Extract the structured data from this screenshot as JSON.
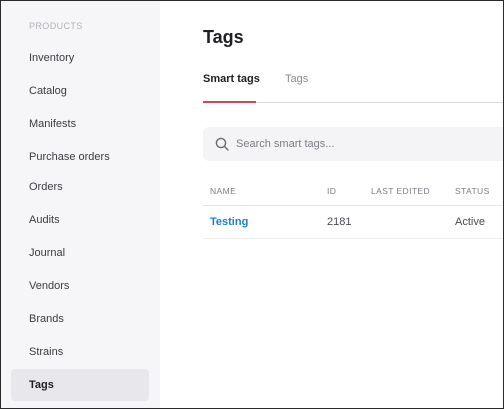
{
  "sidebar": {
    "section": "PRODUCTS",
    "items": [
      {
        "label": "Inventory"
      },
      {
        "label": "Catalog"
      },
      {
        "label": "Manifests"
      },
      {
        "label": "Purchase orders"
      },
      {
        "label": "Orders"
      },
      {
        "label": "Audits"
      },
      {
        "label": "Journal"
      },
      {
        "label": "Vendors"
      },
      {
        "label": "Brands"
      },
      {
        "label": "Strains"
      },
      {
        "label": "Tags",
        "active": true
      }
    ]
  },
  "main": {
    "title": "Tags",
    "tabs": [
      {
        "label": "Smart tags",
        "active": true
      },
      {
        "label": "Tags"
      }
    ],
    "search": {
      "placeholder": "Search smart tags...",
      "value": "",
      "icon": "search-icon"
    },
    "table": {
      "columns": [
        "NAME",
        "ID",
        "LAST EDITED",
        "STATUS"
      ],
      "rows": [
        {
          "name": "Testing",
          "id": "2181",
          "last_edited": "",
          "status": "Active"
        }
      ]
    }
  },
  "colors": {
    "sidebar_bg": "#f6f6f8",
    "active_item_bg": "#e8e8ec",
    "tab_accent": "#e0404f",
    "link": "#1e7fd0"
  }
}
